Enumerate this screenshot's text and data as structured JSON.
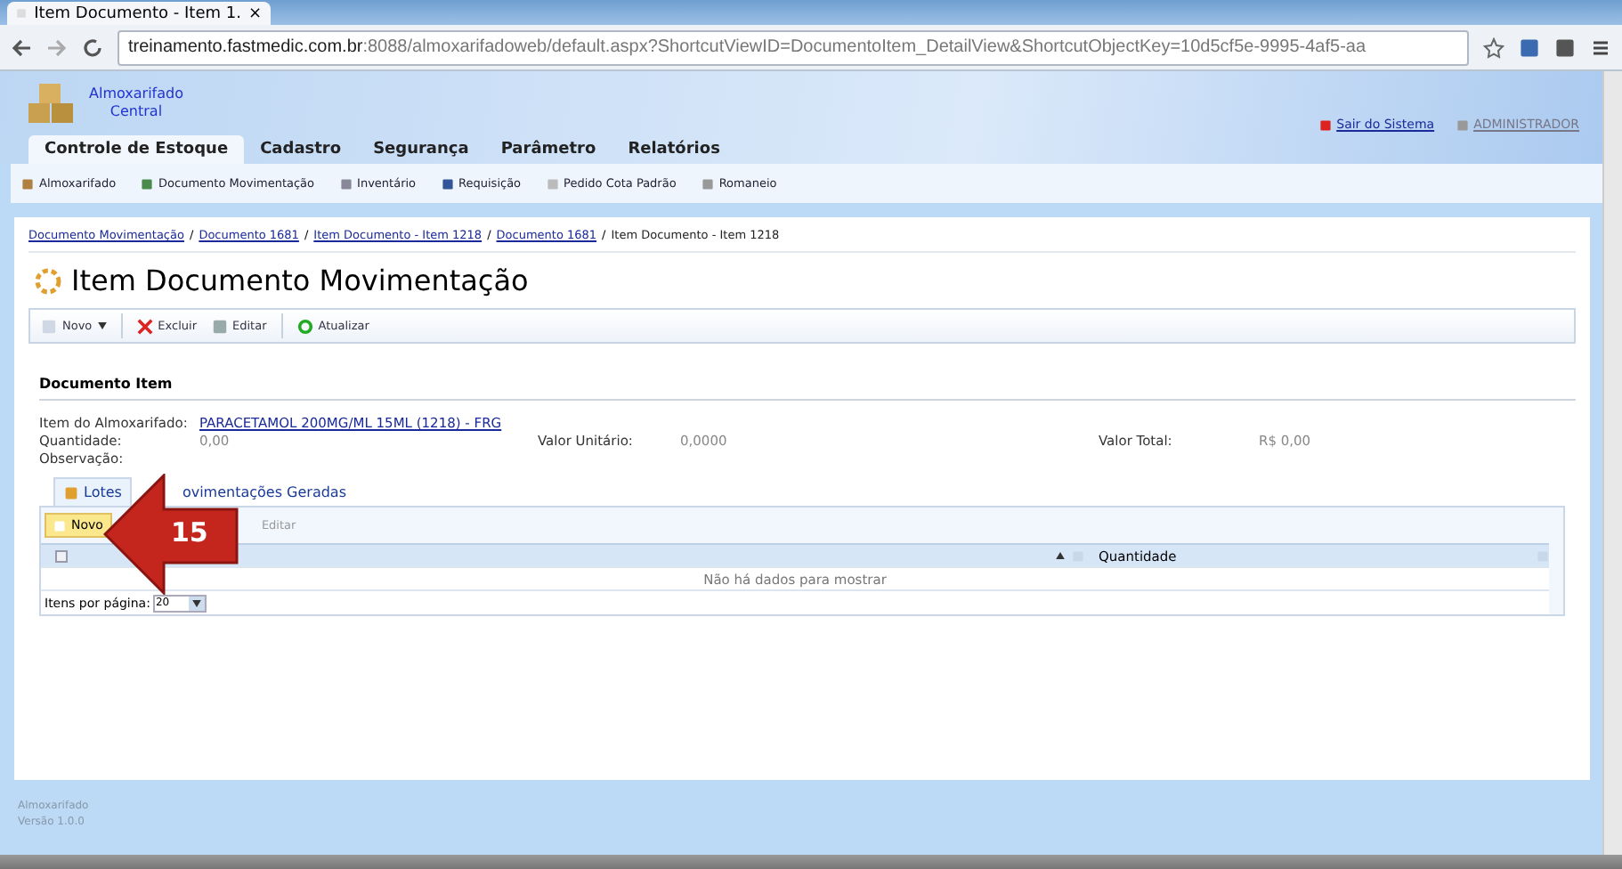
{
  "browser": {
    "tab_title": "Item Documento - Item 1.",
    "tab_close": "×",
    "url_host": "treinamento.fastmedic.com.br",
    "url_rest": ":8088/almoxarifadoweb/default.aspx?ShortcutViewID=DocumentoItem_DetailView&ShortcutObjectKey=10d5cf5e-9995-4af5-aa"
  },
  "header": {
    "app_name": "Almoxarifado",
    "app_sub": "Central",
    "logout": "Sair do Sistema",
    "user": "ADMINISTRADOR"
  },
  "menu_tabs": [
    {
      "label": "Controle de Estoque",
      "selected": true
    },
    {
      "label": "Cadastro",
      "selected": false
    },
    {
      "label": "Segurança",
      "selected": false
    },
    {
      "label": "Parâmetro",
      "selected": false
    },
    {
      "label": "Relatórios",
      "selected": false
    }
  ],
  "submenu": [
    {
      "label": "Almoxarifado",
      "kind": "boxes"
    },
    {
      "label": "Documento Movimentação",
      "kind": "doc"
    },
    {
      "label": "Inventário",
      "kind": "list"
    },
    {
      "label": "Requisição",
      "kind": "req"
    },
    {
      "label": "Pedido Cota Padrão",
      "kind": "order"
    },
    {
      "label": "Romaneio",
      "kind": "tag"
    }
  ],
  "breadcrumb_separator": "/",
  "breadcrumb": [
    {
      "label": "Documento Movimentação",
      "link": true
    },
    {
      "label": "Documento 1681",
      "link": true
    },
    {
      "label": "Item Documento - Item 1218",
      "link": true
    },
    {
      "label": "Documento 1681",
      "link": true
    },
    {
      "label": "Item Documento - Item 1218",
      "link": false
    }
  ],
  "page_title": "Item Documento Movimentação",
  "toolbar": [
    {
      "label": "Novo",
      "kind": "new"
    },
    {
      "label": "Excluir",
      "kind": "delete"
    },
    {
      "label": "Editar",
      "kind": "edit"
    },
    {
      "label": "Atualizar",
      "kind": "refresh"
    }
  ],
  "section_title": "Documento Item",
  "fields": {
    "item_label": "Item do Almoxarifado:",
    "item_value": "PARACETAMOL 200MG/ML 15ML (1218) - FRG",
    "qty_label": "Quantidade:",
    "qty_value": "0,00",
    "unit_label": "Valor Unitário:",
    "unit_value": "0,0000",
    "total_label": "Valor Total:",
    "total_value": "R$ 0,00",
    "obs_label": "Observação:"
  },
  "detail_tabs": [
    {
      "label": "Lotes",
      "selected": true
    },
    {
      "label": "ovimentações Geradas",
      "selected": false
    }
  ],
  "grid": {
    "select_all_checked": false,
    "new_button": "Novo",
    "edit_button": "Editar",
    "column_2": "Quantidade",
    "empty": "Não há dados para mostrar",
    "pager_label": "Itens por página:",
    "page_size": "20"
  },
  "callout": {
    "number": "15"
  },
  "footer": {
    "line1": "Almoxarifado",
    "line2": "Versão 1.0.0"
  }
}
